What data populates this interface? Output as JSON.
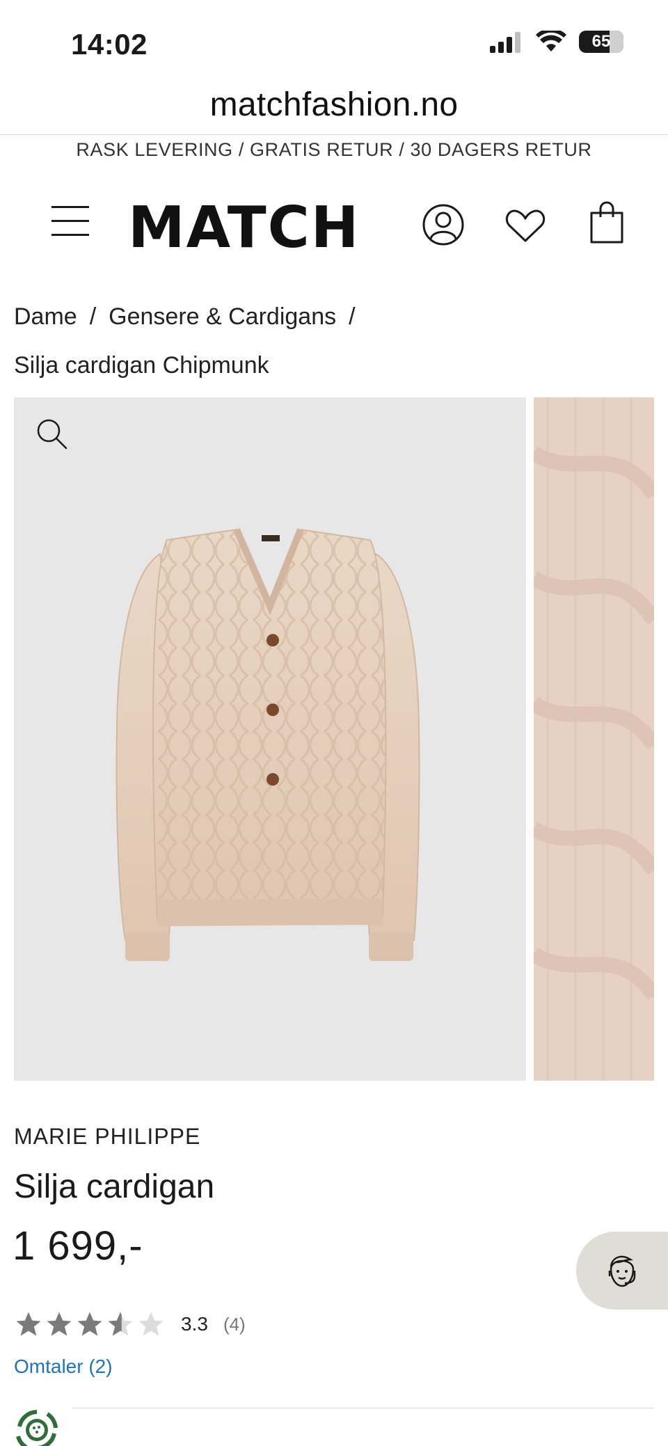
{
  "status_bar": {
    "time": "14:02",
    "battery": "65",
    "icons": [
      "signal-icon",
      "wifi-icon",
      "battery-icon"
    ]
  },
  "browser": {
    "url": "matchfashion.no"
  },
  "promo": {
    "text": "RASK LEVERING / GRATIS RETUR / 30 DAGERS RETUR"
  },
  "header": {
    "logo": "MATCH",
    "icons": [
      "menu-icon",
      "account-icon",
      "wishlist-heart-icon",
      "shopping-bag-icon"
    ]
  },
  "breadcrumb": {
    "items": [
      "Dame",
      "Gensere & Cardigans",
      "Silja cardigan Chipmunk"
    ],
    "separator": "/"
  },
  "product": {
    "brand": "MARIE PHILIPPE",
    "name": "Silja cardigan",
    "price": "1 699,-",
    "rating_value": "3.3",
    "rating_count": "(4)",
    "rating_stars": 3.3,
    "reviews_link": "Omtaler (2)"
  },
  "colors": {
    "accent_link": "#1f74b8",
    "image_bg": "#e7e7e7",
    "cardigan": "#e6cfbc",
    "chat_bg": "#e0dcd6"
  }
}
